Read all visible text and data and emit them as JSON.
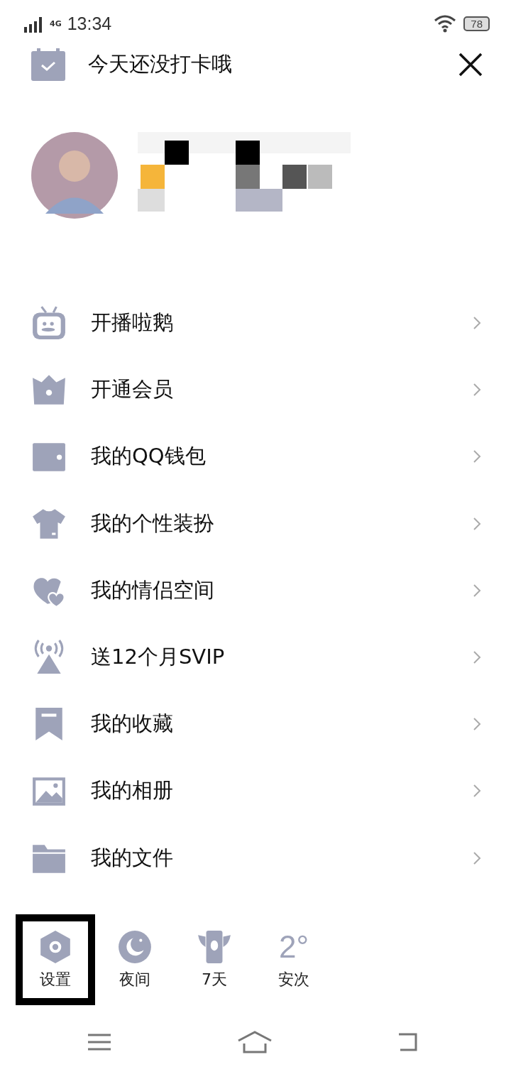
{
  "status_bar": {
    "network": "4G",
    "time": "13:34",
    "battery": "78"
  },
  "header": {
    "title": "今天还没打卡哦"
  },
  "menu": [
    {
      "kind": "tv",
      "label": "开播啦鹅"
    },
    {
      "kind": "crown",
      "label": "开通会员"
    },
    {
      "kind": "wallet",
      "label": "我的QQ钱包"
    },
    {
      "kind": "shirt",
      "label": "我的个性装扮"
    },
    {
      "kind": "hearts",
      "label": "我的情侣空间"
    },
    {
      "kind": "antenna",
      "label": "送12个月SVIP"
    },
    {
      "kind": "bookmark",
      "label": "我的收藏"
    },
    {
      "kind": "image",
      "label": "我的相册"
    },
    {
      "kind": "folder",
      "label": "我的文件"
    }
  ],
  "actions": [
    {
      "kind": "settings",
      "label": "设置",
      "highlighted": true
    },
    {
      "kind": "night",
      "label": "夜间",
      "highlighted": false
    },
    {
      "kind": "checkin",
      "label": "7天",
      "highlighted": false
    },
    {
      "kind": "weather",
      "temperature": "2°",
      "label": "安次",
      "highlighted": false
    }
  ]
}
